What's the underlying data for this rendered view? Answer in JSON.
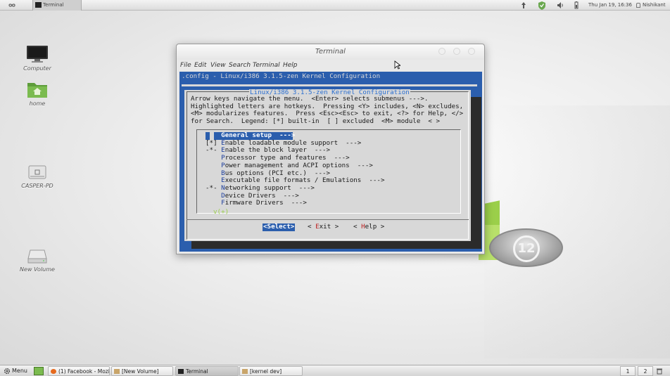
{
  "top_panel": {
    "active_app": "Terminal",
    "clock": "Thu Jan 19, 16:36",
    "user": "Nishikant"
  },
  "desktop_icons": [
    {
      "label": "Computer",
      "icon": "monitor-icon"
    },
    {
      "label": "home",
      "icon": "home-folder-icon"
    },
    {
      "label": "CASPER-PD",
      "icon": "usb-drive-icon"
    },
    {
      "label": "New Volume",
      "icon": "hard-drive-icon"
    }
  ],
  "terminal": {
    "title": "Terminal",
    "menu": [
      "File",
      "Edit",
      "View",
      "Search",
      "Terminal",
      "Help"
    ],
    "config_title": ".config - Linux/i386 3.1.5-zen Kernel Configuration",
    "dialog_title": "Linux/i386 3.1.5-zen Kernel Configuration",
    "help_lines": [
      "Arrow keys navigate the menu.  <Enter> selects submenus --->.",
      "Highlighted letters are hotkeys.  Pressing <Y> includes, <N> excludes,",
      "<M> modularizes features.  Press <Esc><Esc> to exit, <?> for Help, </>",
      "for Search.  Legend: [*] built-in  [ ] excluded  <M> module  < >"
    ],
    "menu_items": [
      {
        "prefix": "    ",
        "hot": "G",
        "rest": "eneral setup  --->",
        "selected": true
      },
      {
        "prefix": "[*] ",
        "hot": "E",
        "rest": "nable loadable module support  --->",
        "selected": false
      },
      {
        "prefix": "-*- ",
        "hot": "E",
        "rest": "nable the block layer  --->",
        "selected": false
      },
      {
        "prefix": "    ",
        "hot": "P",
        "rest": "rocessor type and features  --->",
        "selected": false
      },
      {
        "prefix": "    ",
        "hot": "P",
        "rest": "ower management and ACPI options  --->",
        "selected": false
      },
      {
        "prefix": "    ",
        "hot": "B",
        "rest": "us options (PCI etc.)  --->",
        "selected": false
      },
      {
        "prefix": "    ",
        "hot": "E",
        "rest": "xecutable file formats / Emulations  --->",
        "selected": false
      },
      {
        "prefix": "-*- ",
        "hot": "N",
        "rest": "etworking support  --->",
        "selected": false
      },
      {
        "prefix": "    ",
        "hot": "D",
        "rest": "evice Drivers  --->",
        "selected": false
      },
      {
        "prefix": "    ",
        "hot": "F",
        "rest": "irmware Drivers  --->",
        "selected": false
      }
    ],
    "scroll_indicator": "v(+)",
    "buttons": {
      "select": "<Select>",
      "exit_pre": "< ",
      "exit_hot": "E",
      "exit_rest": "xit >",
      "help_pre": "< ",
      "help_hot": "H",
      "help_rest": "elp >"
    }
  },
  "taskbar": {
    "menu_label": "Menu",
    "tasks": [
      {
        "label": "(1) Facebook - Mozil...",
        "icon": "firefox-icon"
      },
      {
        "label": "[New Volume]",
        "icon": "folder-icon"
      },
      {
        "label": "Terminal",
        "icon": "terminal-icon"
      },
      {
        "label": "[kernel dev]",
        "icon": "folder-icon"
      }
    ],
    "workspaces": [
      "1",
      "2"
    ]
  },
  "colors": {
    "terminal_bg": "#2b5ead",
    "dialog_bg": "#d8d8d8",
    "hotkey": "#1e3f9c",
    "mint_green": "#9bcf4a"
  }
}
